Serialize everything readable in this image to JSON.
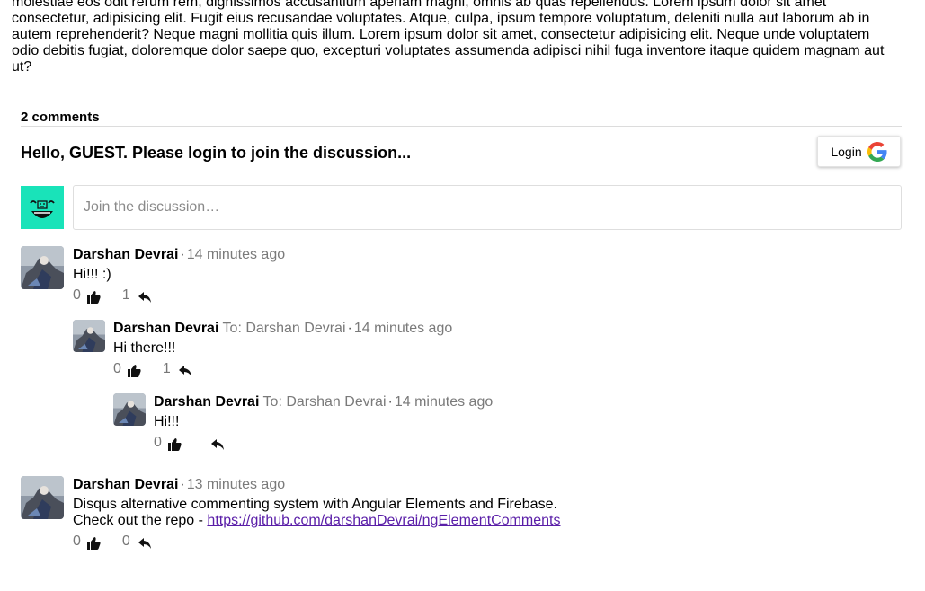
{
  "article": {
    "lines": [
      "molestiae eos odit rerum rem, dignissimos accusantium aperiam magni, omnis ab quas repellendus. Lorem ipsum dolor sit amet",
      "consectetur, adipisicing elit. Fugit eius recusandae voluptates. Atque, culpa, ipsum tempore voluptatum, deleniti nulla aut laborum ab in",
      "autem reprehenderit? Neque magni mollitia quis illum. Lorem ipsum dolor sit amet, consectetur adipisicing elit. Neque unde voluptatem",
      "odio debitis fugiat, doloremque dolor saepe quo, excepturi voluptates assumenda adipisci nihil fuga inventore itaque quidem magnam aut",
      "ut?"
    ]
  },
  "comments_header": {
    "count_label": "2 comments"
  },
  "auth": {
    "greeting": "Hello, GUEST. Please login to join the discussion...",
    "login_label": "Login",
    "login_icon": "google-logo-icon"
  },
  "composer": {
    "placeholder": "Join the discussion…",
    "avatar_icon": "guest-face-icon",
    "avatar_color": "#19e3b9"
  },
  "comments": [
    {
      "author": "Darshan Devrai",
      "to": "",
      "separator": "·",
      "time": "14 minutes ago",
      "text": "Hi!!! :)",
      "likes": "0",
      "replies": "1"
    },
    {
      "author": "Darshan Devrai",
      "to": "To: Darshan Devrai",
      "separator": "·",
      "time": "14 minutes ago",
      "text": "Hi there!!!",
      "likes": "0",
      "replies": "1"
    },
    {
      "author": "Darshan Devrai",
      "to": "To: Darshan Devrai",
      "separator": "·",
      "time": "14 minutes ago",
      "text": "Hi!!!",
      "likes": "0",
      "replies": ""
    },
    {
      "author": "Darshan Devrai",
      "to": "",
      "separator": "·",
      "time": "13 minutes ago",
      "text": "Disqus alternative commenting system with Angular Elements and Firebase.",
      "text2_prefix": "Check out the repo - ",
      "link": "https://github.com/darshanDevrai/ngElementComments",
      "likes": "0",
      "replies": "0"
    }
  ],
  "colors": {
    "link": "#5a1ea8",
    "meta": "#7a7a7a",
    "accent": "#19e3b9"
  }
}
